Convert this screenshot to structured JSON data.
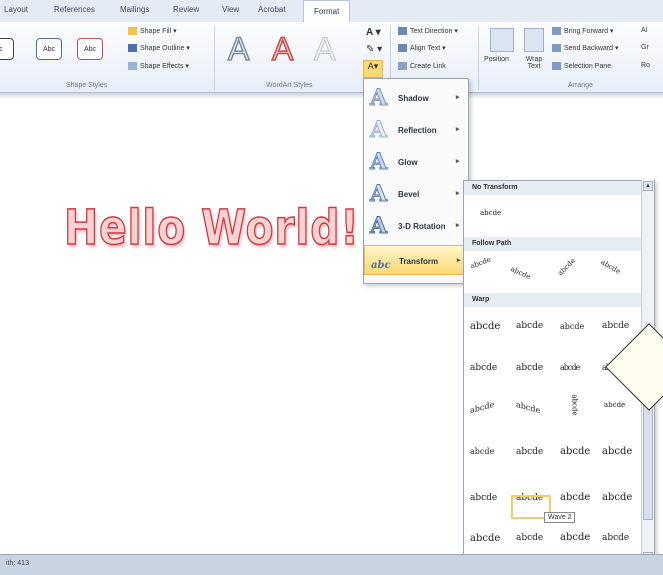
{
  "tabs": [
    "Layout",
    "References",
    "Mailings",
    "Review",
    "View",
    "Acrobat",
    "Format"
  ],
  "ribbon": {
    "shape_styles": {
      "buttons": [
        "Abc",
        "Abc",
        "Abc"
      ],
      "partial": "c",
      "fill": "Shape Fill",
      "outline": "Shape Outline",
      "effects": "Shape Effects",
      "label": "Shape Styles"
    },
    "wordart": {
      "sample": "A",
      "label": "WordArt Styles"
    },
    "text": {
      "direction": "Text Direction",
      "align": "Align Text",
      "link": "Create Link"
    },
    "arrange": {
      "position": "Position",
      "wrap": "Wrap Text",
      "forward": "Bring Forward",
      "backward": "Send Backward",
      "pane": "Selection Pane",
      "label": "Arrange",
      "cut1": "Al",
      "cut2": "Gr",
      "cut3": "Ro"
    }
  },
  "document": {
    "wordart_text": "Hello World!!"
  },
  "status": {
    "text": "ith: 413"
  },
  "effects_menu": [
    {
      "glyph": "A",
      "label": "Shadow"
    },
    {
      "glyph": "A",
      "label": "Reflection"
    },
    {
      "glyph": "A",
      "label": "Glow"
    },
    {
      "glyph": "A",
      "label": "Bevel"
    },
    {
      "glyph": "A",
      "label": "3-D Rotation"
    },
    {
      "glyph": "abc",
      "label": "Transform"
    }
  ],
  "transform": {
    "no_transform": "No Transform",
    "sample": "abcde",
    "follow_path": "Follow Path",
    "path_samples": [
      "abcde",
      "abcde",
      "abcde",
      "abcde"
    ],
    "warp": "Warp",
    "warp_rows": [
      [
        "abcde",
        "abcde",
        "abcde",
        "abcde"
      ],
      [
        "abcde",
        "abcde",
        "abcde",
        "abcde"
      ],
      [
        "abcde",
        "abcde",
        "abcde",
        "abcde"
      ],
      [
        "abcde",
        "abcde",
        "abcde",
        "abcde"
      ],
      [
        "abcde",
        "abcde",
        "abcde",
        "abcde"
      ],
      [
        "abcde",
        "abcde",
        "abcde",
        "abcde"
      ]
    ],
    "tooltip": "Wave 2"
  },
  "colors": {
    "accent": "#d3373f",
    "highlight": "#fbd873"
  }
}
